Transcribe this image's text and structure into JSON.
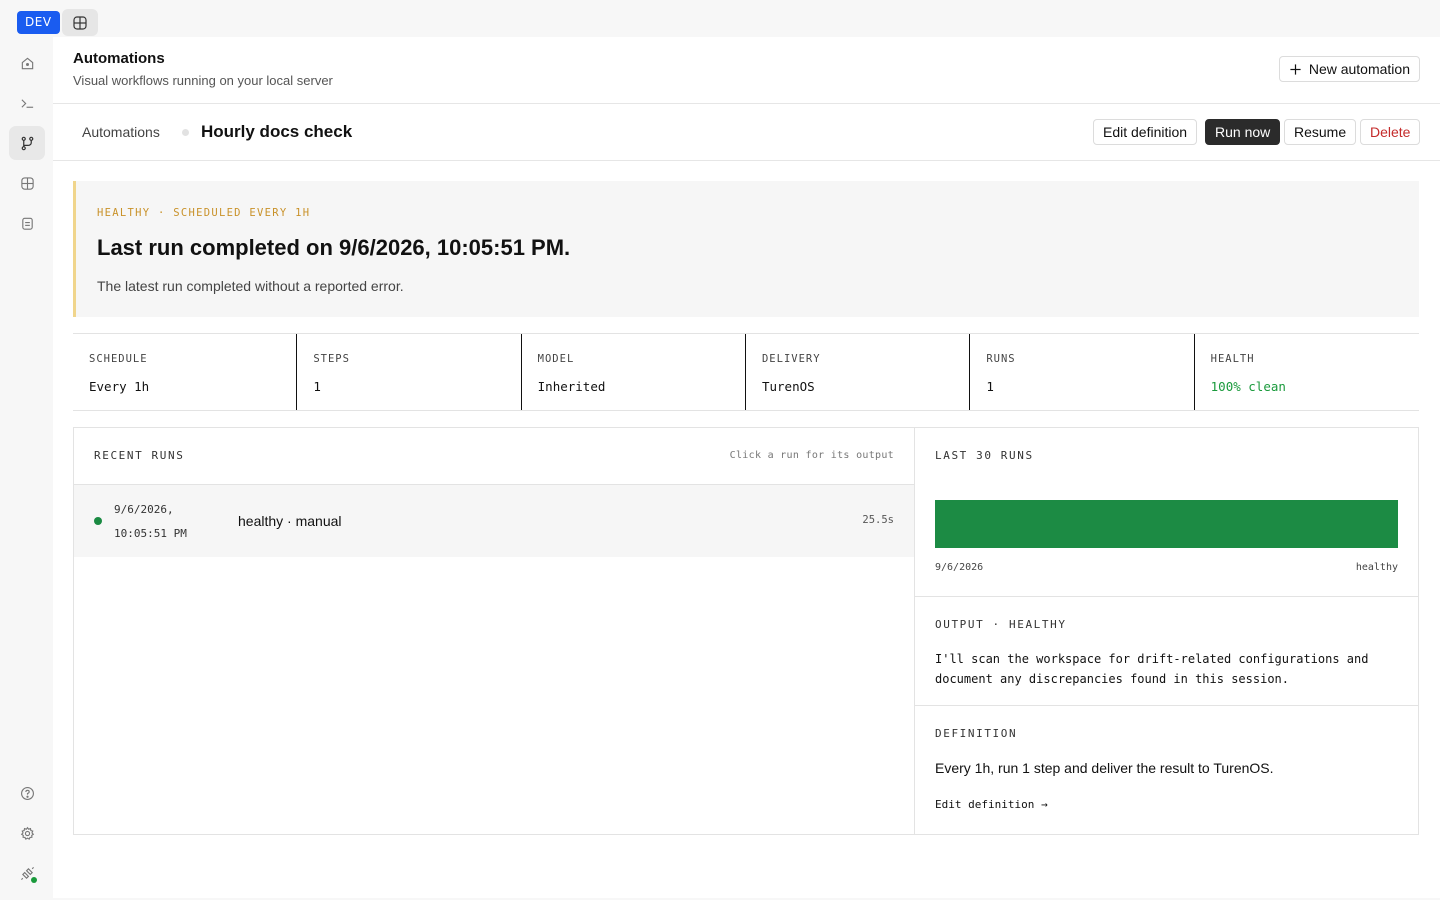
{
  "topbar": {
    "env_badge": "DEV",
    "icon": "workspace-grid-icon"
  },
  "sidebar": {
    "items": [
      {
        "icon": "home-icon",
        "active": false
      },
      {
        "icon": "terminal-icon",
        "active": false
      },
      {
        "icon": "workflow-icon",
        "active": true
      },
      {
        "icon": "grid-plus-icon",
        "active": false
      },
      {
        "icon": "clipboard-icon",
        "active": false
      }
    ],
    "bottom": [
      {
        "icon": "help-icon"
      },
      {
        "icon": "gear-icon"
      },
      {
        "icon": "connection-icon",
        "status_color": "#1a9a3c"
      }
    ]
  },
  "header": {
    "title": "Automations",
    "subtitle": "Visual workflows running on your local server",
    "new_button": "New automation"
  },
  "subheader": {
    "breadcrumb_root": "Automations",
    "current": "Hourly docs check",
    "actions": {
      "edit": "Edit definition",
      "run": "Run now",
      "resume": "Resume",
      "delete": "Delete"
    }
  },
  "banner": {
    "kicker": "HEALTHY · SCHEDULED EVERY 1H",
    "title": "Last run completed on 9/6/2026, 10:05:51 PM.",
    "description": "The latest run completed without a reported error.",
    "accent_color": "#f0d58c"
  },
  "stats": [
    {
      "label": "SCHEDULE",
      "value": "Every 1h"
    },
    {
      "label": "STEPS",
      "value": "1"
    },
    {
      "label": "MODEL",
      "value": "Inherited"
    },
    {
      "label": "DELIVERY",
      "value": "TurenOS"
    },
    {
      "label": "RUNS",
      "value": "1"
    },
    {
      "label": "HEALTH",
      "value": "100% clean"
    }
  ],
  "recent_runs": {
    "title": "RECENT RUNS",
    "hint": "Click a run for its output",
    "rows": [
      {
        "date": "9/6/2026, 10:05:51 PM",
        "label": "healthy · manual",
        "duration": "25.5s",
        "status_color": "#1a8a42"
      }
    ]
  },
  "last_runs": {
    "title": "LAST 30 RUNS",
    "start_label": "9/6/2026",
    "end_label": "healthy",
    "bar_color": "#1c8b44"
  },
  "output": {
    "title": "OUTPUT · HEALTHY",
    "text": "I'll scan the workspace for drift-related configurations and document any discrepancies found in this session."
  },
  "definition": {
    "title": "DEFINITION",
    "text": "Every 1h, run 1 step and deliver the result to TurenOS.",
    "link": "Edit definition →"
  }
}
